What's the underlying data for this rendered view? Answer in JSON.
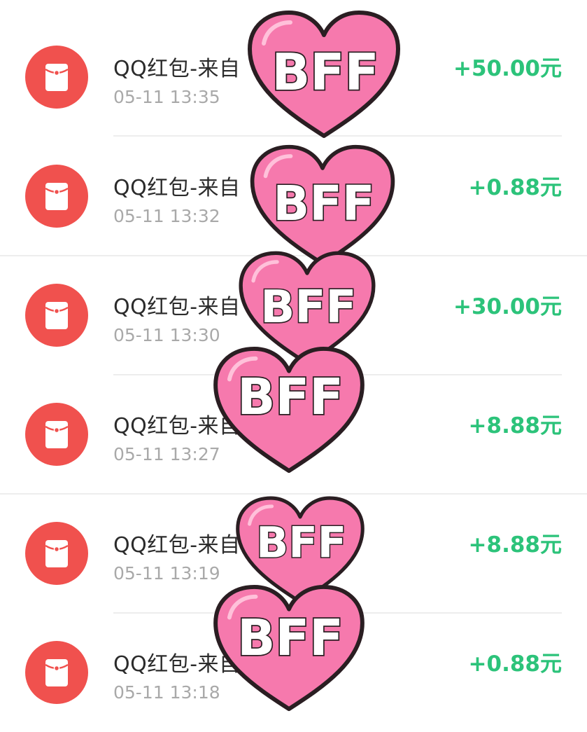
{
  "transactions": [
    {
      "title": "QQ红包-来自",
      "time": "05-11 13:35",
      "amount": "+50.00元"
    },
    {
      "title": "QQ红包-来自",
      "time": "05-11 13:32",
      "amount": "+0.88元"
    },
    {
      "title": "QQ红包-来自",
      "time": "05-11 13:30",
      "amount": "+30.00元"
    },
    {
      "title": "QQ红包-来自",
      "time": "05-11 13:27",
      "amount": "+8.88元"
    },
    {
      "title": "QQ红包-来自",
      "time": "05-11 13:19",
      "amount": "+8.88元"
    },
    {
      "title": "QQ红包-来自",
      "time": "05-11 13:18",
      "amount": "+0.88元"
    }
  ],
  "sticker_text": "BFF",
  "colors": {
    "icon_bg": "#f0514e",
    "amount": "#2cc37a",
    "heart_fill": "#f679ad",
    "heart_outline": "#2a1e22"
  },
  "icons": {
    "transaction_icon": "red-envelope-icon",
    "sticker": "heart-sticker"
  }
}
